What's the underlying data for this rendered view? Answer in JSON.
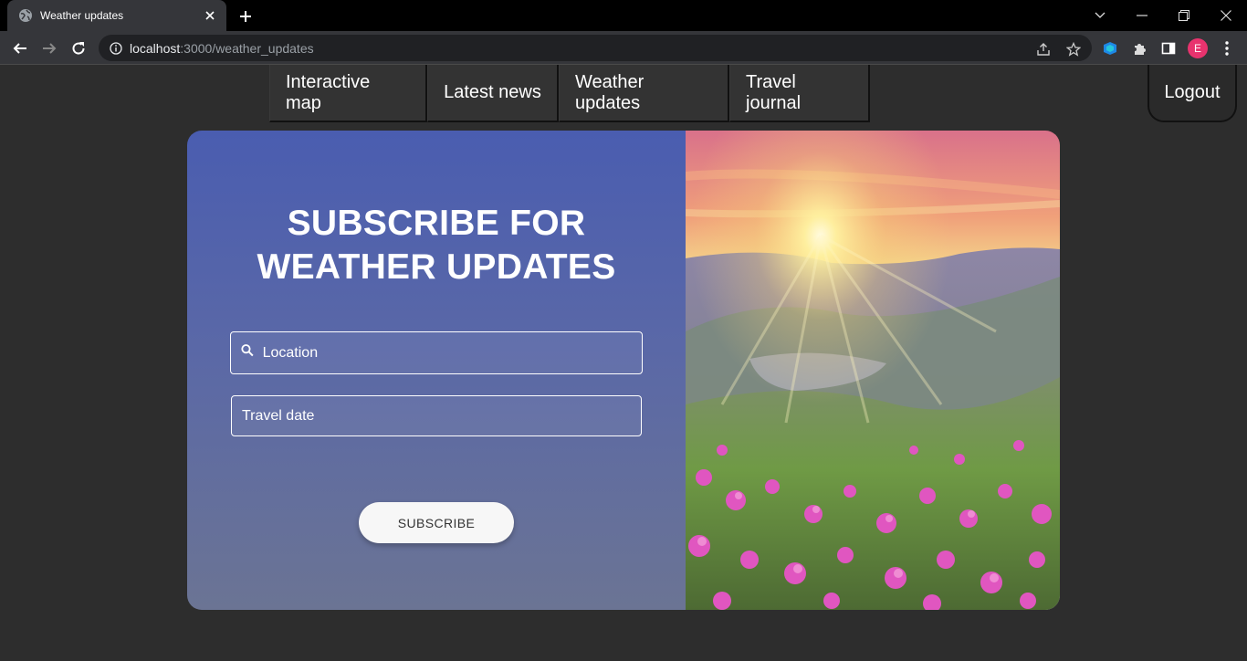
{
  "browser": {
    "tab_title": "Weather updates",
    "url_host": "localhost",
    "url_path": ":3000/weather_updates",
    "profile_initial": "E"
  },
  "nav": {
    "items": [
      {
        "label": "Interactive map"
      },
      {
        "label": "Latest news"
      },
      {
        "label": "Weather updates"
      },
      {
        "label": "Travel journal"
      }
    ],
    "logout_label": "Logout"
  },
  "form": {
    "headline_line1": "SUBSCRIBE FOR",
    "headline_line2": "WEATHER UPDATES",
    "location_placeholder": "Location",
    "travel_date_placeholder": "Travel date",
    "subscribe_label": "SUBSCRIBE"
  },
  "colors": {
    "panel_top": "#4a5db0",
    "panel_bottom": "#6b7494",
    "page_background": "#2d2d2d",
    "avatar": "#e8336e"
  },
  "icons": {
    "favicon": "globe-icon",
    "search": "search-icon",
    "extension": "puzzle-icon"
  }
}
